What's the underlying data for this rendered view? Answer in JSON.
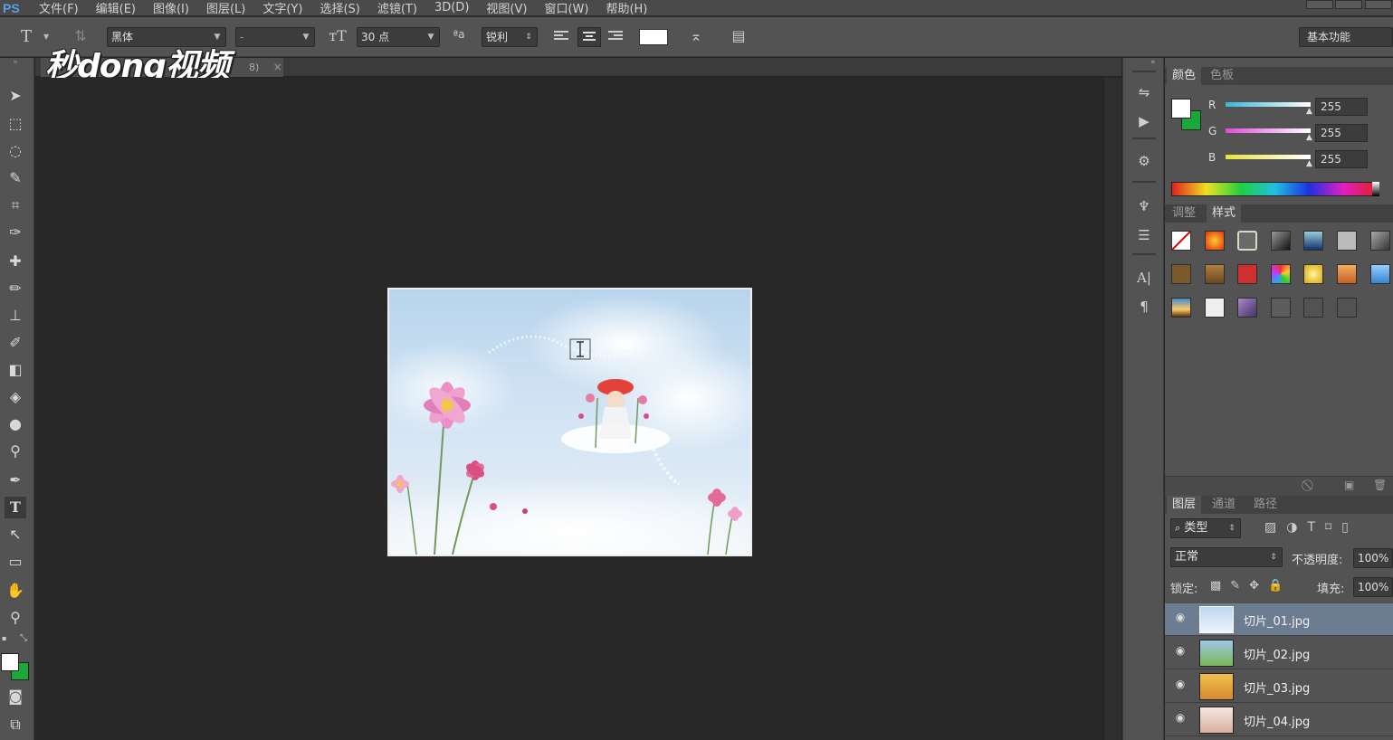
{
  "app": {
    "logo": "PS"
  },
  "menu": [
    "文件(F)",
    "编辑(E)",
    "图像(I)",
    "图层(L)",
    "文字(Y)",
    "选择(S)",
    "滤镜(T)",
    "3D(D)",
    "视图(V)",
    "窗口(W)",
    "帮助(H)"
  ],
  "options": {
    "font_family": "黑体",
    "font_style": "-",
    "font_size": "30 点",
    "antialias": "锐利",
    "workspace": "基本功能"
  },
  "watermark": "秒dong视频",
  "doc_tab": {
    "label_suffix": "8)",
    "close": "×"
  },
  "color_panel": {
    "tabs": [
      "颜色",
      "色板"
    ],
    "channels": [
      {
        "label": "R",
        "value": "255",
        "color": "#3ad0e6"
      },
      {
        "label": "G",
        "value": "255",
        "color": "#e04adf"
      },
      {
        "label": "B",
        "value": "255",
        "color": "#e8e23a"
      }
    ],
    "foreground": "#ffffff",
    "background": "#1aa83a"
  },
  "styles_panel": {
    "tabs": [
      "调整",
      "样式"
    ]
  },
  "layers_panel": {
    "tabs": [
      "图层",
      "通道",
      "路径"
    ],
    "filter_label": "类型",
    "blend_mode": "正常",
    "opacity_label": "不透明度:",
    "opacity_value": "100%",
    "lock_label": "锁定:",
    "fill_label": "填充:",
    "fill_value": "100%",
    "layers": [
      {
        "name": "切片_01.jpg",
        "selected": true
      },
      {
        "name": "切片_02.jpg",
        "selected": false
      },
      {
        "name": "切片_03.jpg",
        "selected": false
      },
      {
        "name": "切片_04.jpg",
        "selected": false
      }
    ]
  },
  "icons": {
    "type_tool": "T",
    "eye": "eye-icon"
  }
}
